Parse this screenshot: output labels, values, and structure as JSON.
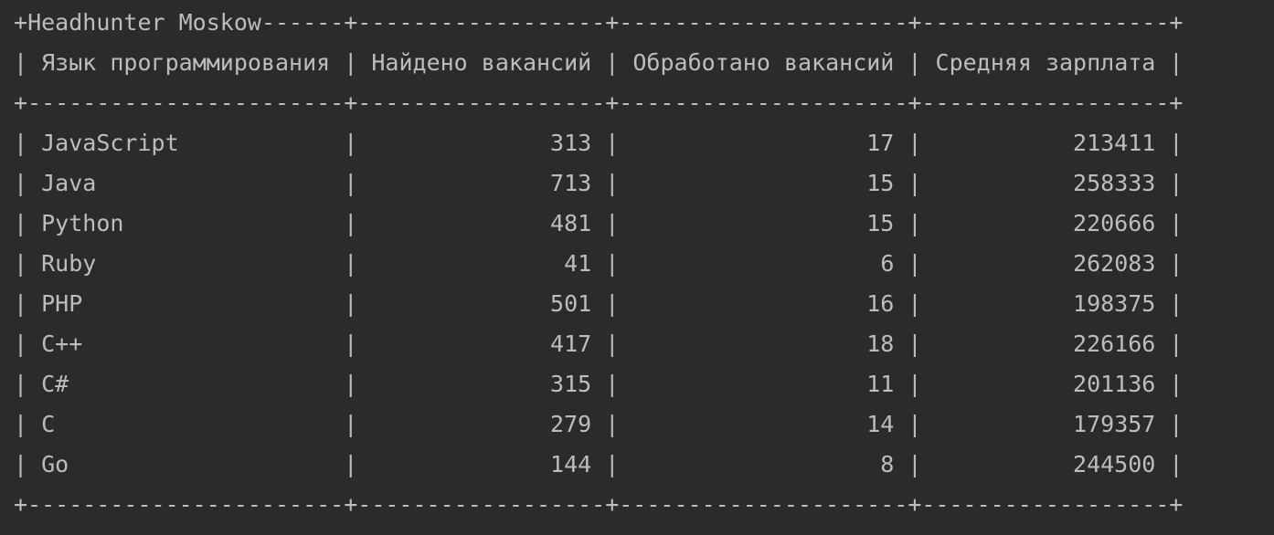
{
  "table": {
    "title": "Headhunter Moskow",
    "headers": [
      "Язык программирования",
      "Найдено вакансий",
      "Обработано вакансий",
      "Средняя зарплата"
    ],
    "rows": [
      [
        "JavaScript",
        "313",
        "17",
        "213411"
      ],
      [
        "Java",
        "713",
        "15",
        "258333"
      ],
      [
        "Python",
        "481",
        "15",
        "220666"
      ],
      [
        "Ruby",
        "41",
        "6",
        "262083"
      ],
      [
        "PHP",
        "501",
        "16",
        "198375"
      ],
      [
        "C++",
        "417",
        "18",
        "226166"
      ],
      [
        "C#",
        "315",
        "11",
        "201136"
      ],
      [
        "C",
        "279",
        "14",
        "179357"
      ],
      [
        "Go",
        "144",
        "8",
        "244500"
      ]
    ],
    "align": [
      "left",
      "right",
      "right",
      "right"
    ]
  },
  "colors": {
    "background": "#2b2b2b",
    "text": "#bdbdbd"
  }
}
